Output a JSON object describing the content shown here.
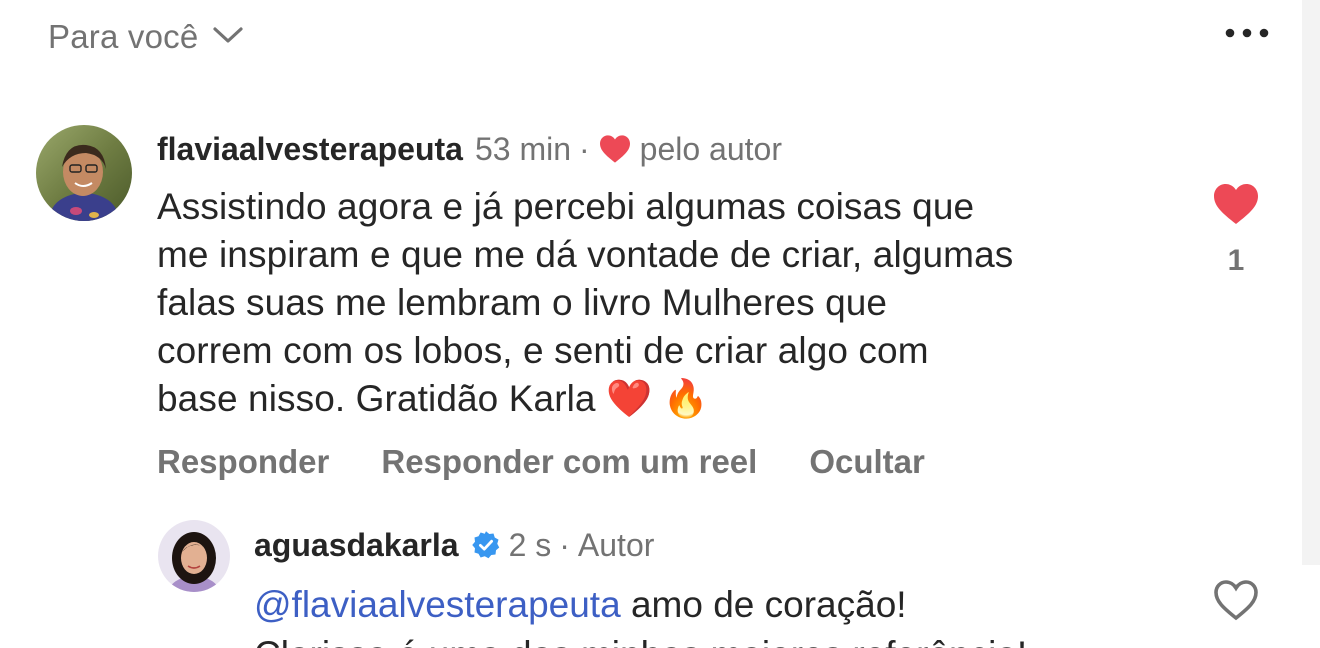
{
  "header": {
    "filter_label": "Para você",
    "chevron_icon": "chevron-down-icon",
    "more_icon": "more-horizontal-icon"
  },
  "comment": {
    "username": "flaviaalvesterapeuta",
    "time": "53 min",
    "separator": "·",
    "liked_by_author_label": "pelo autor",
    "text_lines": [
      "Assistindo agora e já percebi algumas coisas que",
      "me inspiram e que me dá vontade de criar, algumas",
      "falas suas me lembram o livro Mulheres que",
      "correm com os lobos, e senti de criar algo com",
      "base nisso. Gratidão Karla ❤️ 🔥"
    ],
    "like_count": "1",
    "liked": true,
    "actions": {
      "reply": "Responder",
      "reply_with_reel": "Responder com um reel",
      "hide": "Ocultar"
    }
  },
  "reply": {
    "username": "aguasdakarla",
    "verified": true,
    "time": "2 s",
    "separator": "·",
    "role": "Autor",
    "mention": "@flaviaalvesterapeuta",
    "text_after_mention": " amo de coração!",
    "line2": "Clarissa é uma das minhas maiores referência!",
    "liked": false
  },
  "colors": {
    "heart_red": "#ed4956",
    "verified_blue": "#3897f0",
    "mention_blue": "#3d5fc4",
    "secondary_text": "#737373"
  }
}
